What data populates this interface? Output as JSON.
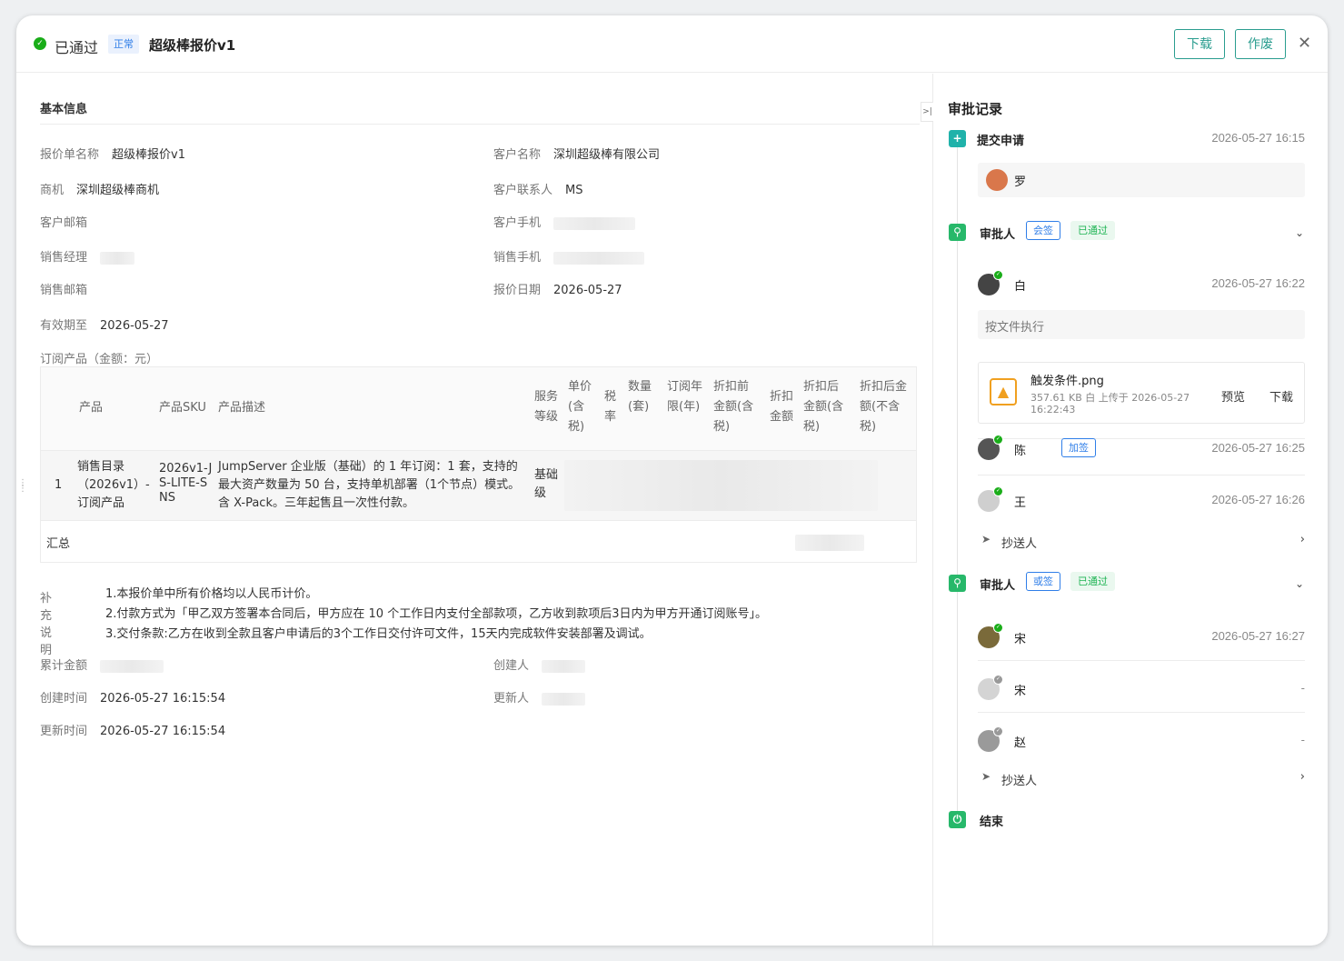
{
  "header": {
    "status": "已通过",
    "tag": "正常",
    "title": "超级棒报价v1",
    "download": "下载",
    "void": "作废",
    "close": "✕"
  },
  "main": {
    "section_title": "基本信息",
    "fields": {
      "quote_name_label": "报价单名称",
      "quote_name": "超级棒报价v1",
      "customer_label": "客户名称",
      "customer": "深圳超级棒有限公司",
      "opportunity_label": "商机",
      "opportunity": "深圳超级棒商机",
      "contact_label": "客户联系人",
      "contact": "MS",
      "email_label": "客户邮箱",
      "phone_label": "客户手机",
      "sales_mgr_label": "销售经理",
      "sales_phone_label": "销售手机",
      "sales_email_label": "销售邮箱",
      "quote_date_label": "报价日期",
      "quote_date": "2026-05-27",
      "valid_label": "有效期至",
      "valid": "2026-05-27",
      "products_label": "订阅产品（金额：元）"
    },
    "table": {
      "headers": {
        "product": "产品",
        "sku": "产品SKU",
        "desc": "产品描述",
        "service": "服务等级",
        "price": "单价(含税)",
        "tax": "税率",
        "qty": "数量(套)",
        "years": "订阅年限(年)",
        "pre": "折扣前金额(含税)",
        "disc": "折扣金额",
        "after": "折扣后金额(含税)",
        "after_ex": "折扣后金额(不含税)"
      },
      "row": {
        "no": "1",
        "product": "销售目录（2026v1）- 订阅产品",
        "sku": "2026v1-JS-LITE-SNS",
        "desc": "JumpServer 企业版（基础）的 1 年订阅：1 套，支持的最大资产数量为 50 台，支持单机部署（1个节点）模式。含 X-Pack。三年起售且一次性付款。",
        "service": "基础级"
      },
      "total": "汇总"
    },
    "notes": {
      "label": "补充说明",
      "lines": [
        "1.本报价单中所有价格均以人民币计价。",
        "2.付款方式为「甲乙双方签署本合同后，甲方应在 10 个工作日内支付全部款项，乙方收到款项后3日内为甲方开通订阅账号」。",
        "3.交付条款:乙方在收到全款且客户申请后的3个工作日交付许可文件，15天内完成软件安装部署及调试。"
      ]
    },
    "meta": {
      "total_label": "累计金额",
      "creator_label": "创建人",
      "created_label": "创建时间",
      "created": "2026-05-27 16:15:54",
      "updater_label": "更新人",
      "updated_label": "更新时间",
      "updated": "2026-05-27 16:15:54"
    }
  },
  "sidebar": {
    "title": "审批记录",
    "submit": {
      "label": "提交申请",
      "time": "2026-05-27 16:15",
      "user": "罗"
    },
    "step1": {
      "label": "审批人",
      "type": "会签",
      "status": "已通过",
      "a1": {
        "name": "白",
        "time": "2026-05-27 16:22",
        "comment": "按文件执行"
      },
      "file": {
        "name": "触发条件.png",
        "meta": "357.61 KB 白  上传于 2026-05-27",
        "meta2": "16:22:43",
        "preview": "预览",
        "download": "下载"
      },
      "a2": {
        "name": "陈",
        "tag": "加签",
        "time": "2026-05-27 16:25"
      },
      "a3": {
        "name": "王",
        "time": "2026-05-27 16:26"
      },
      "cc": "抄送人"
    },
    "step2": {
      "label": "审批人",
      "type": "或签",
      "status": "已通过",
      "a1": {
        "name": "宋",
        "time": "2026-05-27 16:27"
      },
      "a2": {
        "name": "宋",
        "time": "-"
      },
      "a3": {
        "name": "赵",
        "time": "-"
      },
      "cc": "抄送人"
    },
    "end": "结束"
  }
}
